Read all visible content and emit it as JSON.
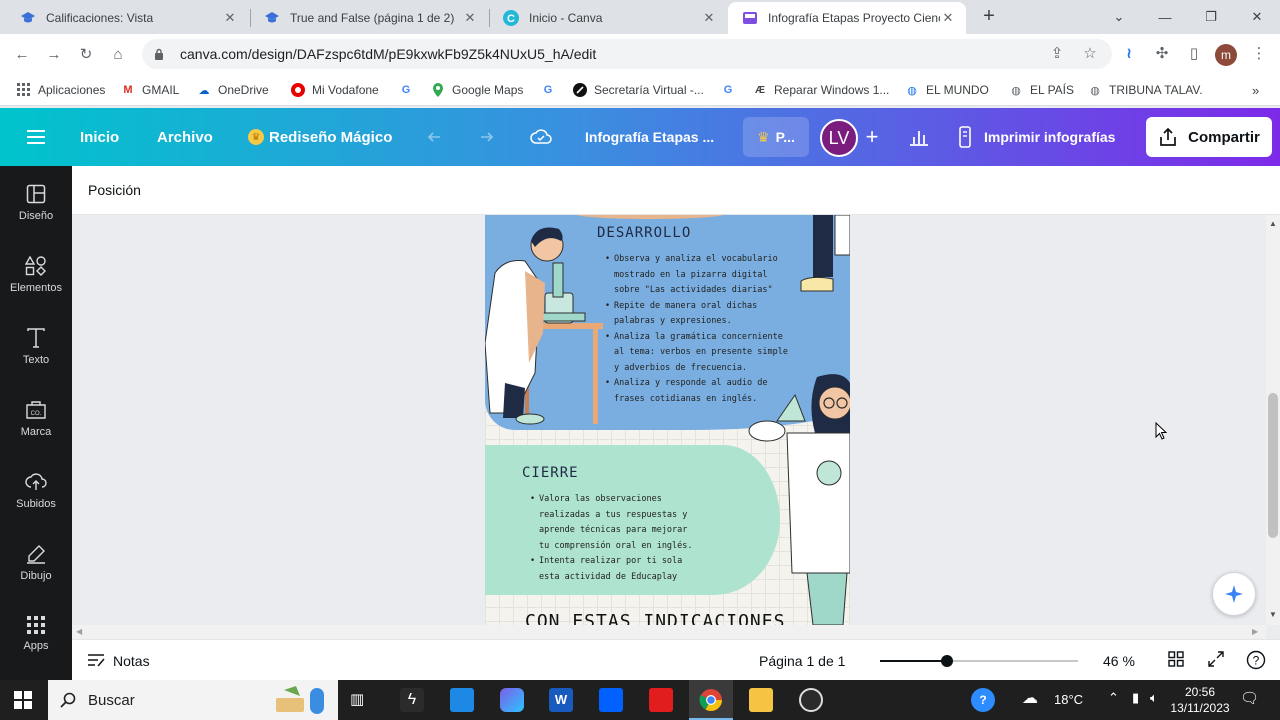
{
  "browser": {
    "tabs": [
      {
        "title": "Calificaciones: Vista",
        "icon": "graduation-cap-icon",
        "active": false
      },
      {
        "title": "True and False (página 1 de 2)",
        "icon": "graduation-cap-icon",
        "active": false
      },
      {
        "title": "Inicio - Canva",
        "icon": "canva-icon",
        "active": false
      },
      {
        "title": "Infografía Etapas Proyecto Cienc",
        "icon": "canva-icon",
        "active": true
      }
    ],
    "url": "canva.com/design/DAFzspc6tdM/pE9kxwkFb9Z5k4NUxU5_hA/edit",
    "profile_initial": "m",
    "bookmarks": [
      {
        "label": "Aplicaciones",
        "icon": "apps-grid-icon"
      },
      {
        "label": "GMAIL",
        "icon": "gmail-icon"
      },
      {
        "label": "OneDrive",
        "icon": "cloud-icon"
      },
      {
        "label": "Mi Vodafone",
        "icon": "vodafone-icon"
      },
      {
        "label": "",
        "icon": "google-icon"
      },
      {
        "label": "Google Maps",
        "icon": "maps-pin-icon"
      },
      {
        "label": "",
        "icon": "google-icon"
      },
      {
        "label": "Secretaría Virtual -...",
        "icon": "secretaria-icon"
      },
      {
        "label": "",
        "icon": "google-icon"
      },
      {
        "label": "Reparar Windows 1...",
        "icon": "ae-icon"
      },
      {
        "label": "EL MUNDO",
        "icon": "globe-icon"
      },
      {
        "label": "EL PAÍS",
        "icon": "globe-icon"
      },
      {
        "label": "TRIBUNA TALAV.",
        "icon": "globe-icon"
      }
    ]
  },
  "canva": {
    "header": {
      "inicio": "Inicio",
      "archivo": "Archivo",
      "magic": "Rediseño Mágico",
      "doc_title": "Infografía Etapas ...",
      "pro_label": "P...",
      "avatar_initials": "LV",
      "print": "Imprimir infografías",
      "share": "Compartir"
    },
    "rail": [
      {
        "label": "Diseño",
        "icon": "design-icon"
      },
      {
        "label": "Elementos",
        "icon": "elements-icon"
      },
      {
        "label": "Texto",
        "icon": "text-icon"
      },
      {
        "label": "Marca",
        "icon": "brand-icon"
      },
      {
        "label": "Subidos",
        "icon": "upload-icon"
      },
      {
        "label": "Dibujo",
        "icon": "draw-icon"
      },
      {
        "label": "Apps",
        "icon": "apps-icon"
      }
    ],
    "context_bar": {
      "position": "Posición"
    },
    "design": {
      "desarrollo": {
        "title": "DESARROLLO",
        "bullets": [
          "Observa y analiza el vocabulario mostrado en la pizarra digital sobre \"Las actividades diarias\"",
          "Repite de manera oral dichas palabras y expresiones.",
          "Analiza la gramática concerniente al tema: verbos en presente simple y adverbios de frecuencia.",
          "Analiza y responde al audio de frases cotidianas en inglés."
        ]
      },
      "cierre": {
        "title": "CIERRE",
        "bullets": [
          "Valora las observaciones realizadas a tus respuestas y aprende técnicas para mejorar tu comprensión oral en inglés.",
          "Intenta realizar por ti sola esta actividad de Educaplay"
        ]
      },
      "bottom_title": "CON ESTAS INDICACIONES"
    },
    "footer": {
      "notes": "Notas",
      "page": "Página 1 de 1",
      "zoom": "46 %",
      "zoom_fraction": 0.46
    }
  },
  "taskbar": {
    "search": "Buscar",
    "temperature": "18°C",
    "time": "20:56",
    "date": "13/11/2023"
  },
  "colors": {
    "canva_gradient_start": "#00c4cc",
    "canva_gradient_end": "#7d2ae8",
    "rail_bg": "#18191b",
    "blue_section": "#7aaee0",
    "mint_section": "#aee3d0"
  }
}
